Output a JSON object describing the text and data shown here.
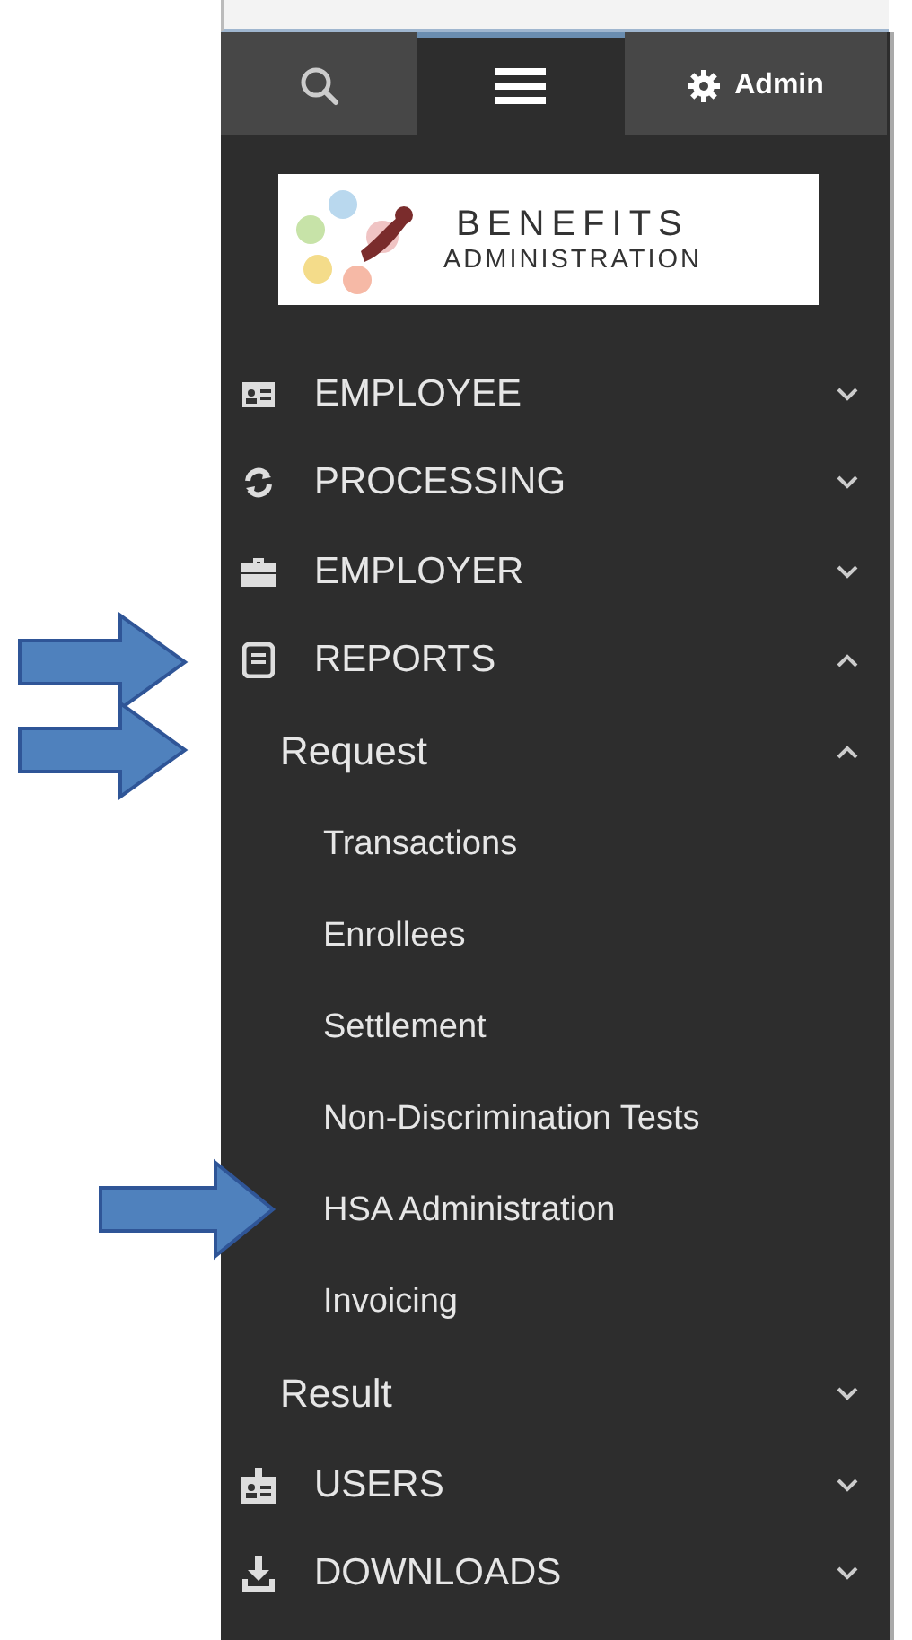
{
  "tabs": [
    {
      "kind": "search",
      "selected": false
    },
    {
      "kind": "menu",
      "selected": true
    },
    {
      "kind": "settings",
      "label": "Admin",
      "selected": false
    }
  ],
  "logo": {
    "line_1": "BENEFITS",
    "line_2": "ADMINISTRATION"
  },
  "menu": [
    {
      "kind": "id-card",
      "label": "EMPLOYEE",
      "expanded": false,
      "arrow": false
    },
    {
      "kind": "sync",
      "label": "PROCESSING",
      "expanded": false,
      "arrow": false
    },
    {
      "kind": "briefcase",
      "label": "EMPLOYER",
      "expanded": false,
      "arrow": false
    },
    {
      "kind": "report",
      "label": "REPORTS",
      "expanded": true,
      "arrow": true,
      "children": [
        {
          "label": "Request",
          "expanded": true,
          "arrow": true,
          "children": [
            {
              "label": "Transactions",
              "arrow": false
            },
            {
              "label": "Enrollees",
              "arrow": false
            },
            {
              "label": "Settlement",
              "arrow": false
            },
            {
              "label": "Non-Discrimination Tests",
              "arrow": false
            },
            {
              "label": "HSA Administration",
              "arrow": true
            },
            {
              "label": "Invoicing",
              "arrow": false
            }
          ]
        },
        {
          "label": "Result",
          "expanded": false,
          "arrow": false
        }
      ]
    },
    {
      "kind": "badge",
      "label": "USERS",
      "expanded": false,
      "arrow": false
    },
    {
      "kind": "download",
      "label": "DOWNLOADS",
      "expanded": false,
      "arrow": false
    }
  ]
}
